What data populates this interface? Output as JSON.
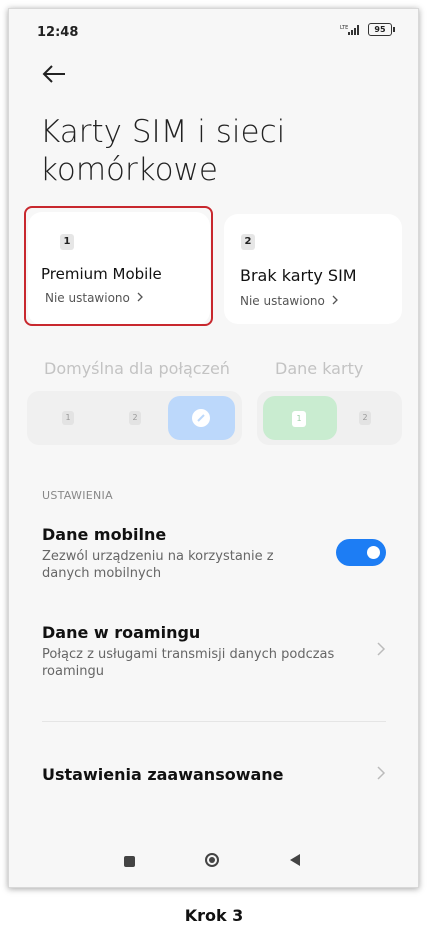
{
  "status": {
    "time": "12:48",
    "network": "LTE",
    "battery": "95"
  },
  "title": "Karty SIM i sieci komórkowe",
  "sim_cards": [
    {
      "slot": "1",
      "name": "Premium Mobile",
      "status": "Nie ustawiono"
    },
    {
      "slot": "2",
      "name": "Brak karty SIM",
      "status": "Nie ustawiono"
    }
  ],
  "defaults": {
    "calls_label": "Domyślna dla połączeń",
    "data_label": "Dane karty",
    "calls_options": [
      "1",
      "2"
    ],
    "data_options": [
      "1",
      "2"
    ],
    "data_selected": "1"
  },
  "settings": {
    "section_label": "USTAWIENIA",
    "mobile_data": {
      "title": "Dane mobilne",
      "subtitle": "Zezwól urządzeniu na korzystanie z danych mobilnych",
      "enabled": true
    },
    "roaming": {
      "title": "Dane w roamingu",
      "subtitle": "Połącz z usługami transmisji danych podczas roamingu"
    },
    "advanced": {
      "title": "Ustawienia zaawansowane"
    }
  },
  "colors": {
    "accent": "#1d7df4",
    "highlight": "#c8282e"
  },
  "caption": "Krok 3"
}
